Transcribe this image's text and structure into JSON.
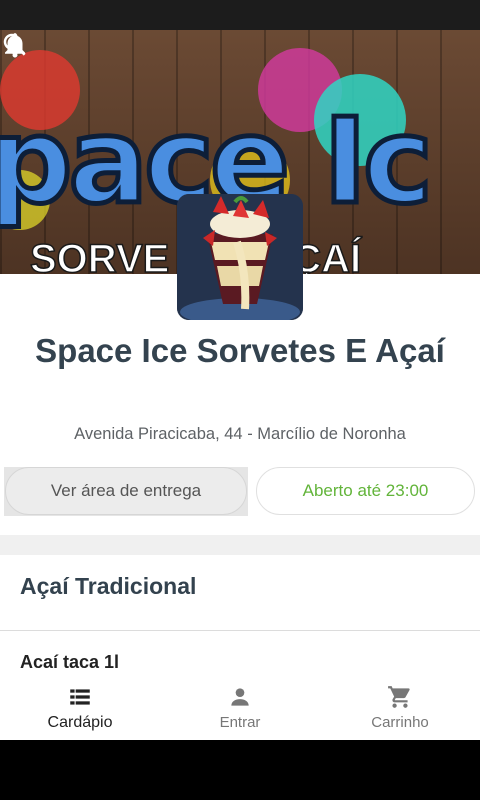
{
  "header": {
    "banner_art_text_top": "pace Ic",
    "banner_art_text_bottom": "SORVE     & AÇAÍ",
    "icons": [
      "bell-icon",
      "search-icon",
      "more-vert-icon"
    ]
  },
  "store": {
    "name": "Space Ice Sorvetes E Açaí",
    "address": "Avenida Piracicaba, 44 - Marcílio de Noronha"
  },
  "actions": {
    "delivery_area_label": "Ver área de entrega",
    "open_status_label": "Aberto até 23:00"
  },
  "menu": {
    "section_title": "Açaí Tradicional",
    "first_item": "Acaí taca 1l"
  },
  "bottom_nav": {
    "items": [
      {
        "label": "Cardápio",
        "icon": "list-icon",
        "active": true
      },
      {
        "label": "Entrar",
        "icon": "person-icon",
        "active": false
      },
      {
        "label": "Carrinho",
        "icon": "cart-icon",
        "active": false
      }
    ]
  },
  "colors": {
    "open_status": "#62b43a",
    "title": "#34434f",
    "banner_letters": "#4a8ee0"
  }
}
